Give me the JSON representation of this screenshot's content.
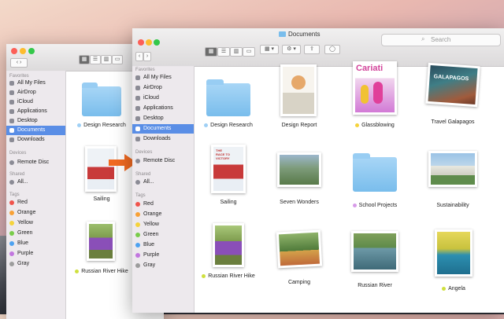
{
  "colors": {
    "accent": "#5a8ee6",
    "arrow": "#f26a21"
  },
  "back_window": {
    "sidebar": {
      "favorites_header": "Favorites",
      "favorites": [
        "All My Files",
        "AirDrop",
        "iCloud",
        "Applications",
        "Desktop",
        "Documents",
        "Downloads"
      ],
      "devices_header": "Devices",
      "devices": [
        "Remote Disc"
      ],
      "shared_header": "Shared",
      "shared": [
        "All..."
      ],
      "tags_header": "Tags",
      "tags": [
        "Red",
        "Orange",
        "Yellow",
        "Green",
        "Blue",
        "Purple",
        "Gray"
      ]
    },
    "items": [
      "Design Research",
      "Sailing",
      "Russian River Hike"
    ]
  },
  "front_window": {
    "title": "Documents",
    "search_placeholder": "Search",
    "sidebar": {
      "favorites_header": "Favorites",
      "favorites": [
        "All My Files",
        "AirDrop",
        "iCloud",
        "Applications",
        "Desktop",
        "Documents",
        "Downloads"
      ],
      "devices_header": "Devices",
      "devices": [
        "Remote Disc"
      ],
      "shared_header": "Shared",
      "shared": [
        "All..."
      ],
      "tags_header": "Tags",
      "tags": [
        "Red",
        "Orange",
        "Yellow",
        "Green",
        "Blue",
        "Purple",
        "Gray"
      ]
    },
    "items": [
      "Design Research",
      "Design Report",
      "Glassblowing",
      "Travel Galapagos",
      "Sailing",
      "Seven Wonders",
      "School Projects",
      "Sustainability",
      "Russian River Hike",
      "Camping",
      "Russian River",
      "Angela"
    ],
    "thumb_texts": {
      "cariati": "Cariati",
      "galapagos": "GALAPAGOS",
      "sailing": "THE RACE TO VICTORY"
    }
  }
}
